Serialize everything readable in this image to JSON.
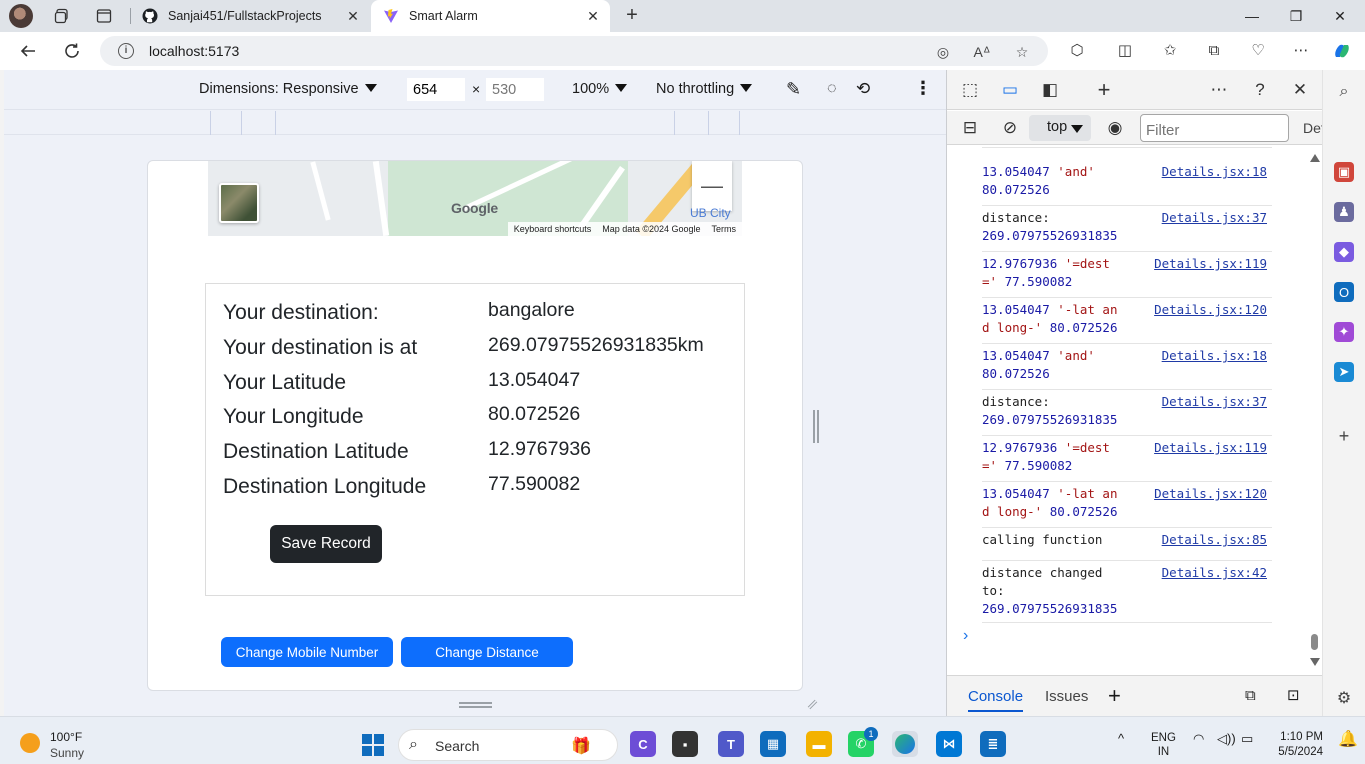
{
  "browser": {
    "tabs": [
      {
        "title": "Sanjai451/FullstackProjects",
        "favicon": "github-icon"
      },
      {
        "title": "Smart Alarm",
        "favicon": "vite-icon",
        "active": true
      }
    ],
    "url": "localhost:5173"
  },
  "device_toolbar": {
    "dimensions_label": "Dimensions: Responsive",
    "width_value": "654",
    "times": "×",
    "height_value": "530",
    "zoom": "100%",
    "throttling": "No throttling"
  },
  "map": {
    "brand": "Google",
    "shortcuts": "Keyboard shortcuts",
    "map_data": "Map data ©2024 Google",
    "terms": "Terms",
    "zoom_out": "—",
    "place_label": "UB City"
  },
  "details": {
    "rows": [
      {
        "label": "Your destination:",
        "value": "bangalore"
      },
      {
        "label": "Your destination is at",
        "value": "269.07975526931835km"
      },
      {
        "label": "Your Latitude",
        "value": "13.054047"
      },
      {
        "label": "Your Longitude",
        "value": "80.072526"
      },
      {
        "label": "Destination Latitude",
        "value": "12.9767936"
      },
      {
        "label": "Destination Longitude",
        "value": "77.590082"
      }
    ],
    "save_button": "Save Record"
  },
  "actions": {
    "change_mobile": "Change Mobile Number",
    "change_distance": "Change Distance"
  },
  "devtools": {
    "context": "top",
    "filter_placeholder": "Filter",
    "filter_tail": "Def",
    "logs": [
      {
        "parts": [
          [
            "num",
            "13.054047"
          ],
          [
            "txt",
            " "
          ],
          [
            "str",
            "'and'"
          ],
          [
            "txt",
            "\n"
          ],
          [
            "num",
            "80.072526"
          ]
        ],
        "source": "Details.jsx:18"
      },
      {
        "parts": [
          [
            "txt",
            "distance:\n"
          ],
          [
            "num",
            "269.07975526931835"
          ]
        ],
        "source": "Details.jsx:37"
      },
      {
        "parts": [
          [
            "num",
            "12.9767936"
          ],
          [
            "txt",
            " "
          ],
          [
            "str",
            "'=dest\n='"
          ],
          [
            "txt",
            " "
          ],
          [
            "num",
            "77.590082"
          ]
        ],
        "source": "Details.jsx:119"
      },
      {
        "parts": [
          [
            "num",
            "13.054047"
          ],
          [
            "txt",
            " "
          ],
          [
            "str",
            "'-lat an\nd long-'"
          ],
          [
            "txt",
            " "
          ],
          [
            "num",
            "80.072526"
          ]
        ],
        "source": "Details.jsx:120"
      },
      {
        "parts": [
          [
            "num",
            "13.054047"
          ],
          [
            "txt",
            " "
          ],
          [
            "str",
            "'and'"
          ],
          [
            "txt",
            "\n"
          ],
          [
            "num",
            "80.072526"
          ]
        ],
        "source": "Details.jsx:18"
      },
      {
        "parts": [
          [
            "txt",
            "distance:\n"
          ],
          [
            "num",
            "269.07975526931835"
          ]
        ],
        "source": "Details.jsx:37"
      },
      {
        "parts": [
          [
            "num",
            "12.9767936"
          ],
          [
            "txt",
            " "
          ],
          [
            "str",
            "'=dest\n='"
          ],
          [
            "txt",
            " "
          ],
          [
            "num",
            "77.590082"
          ]
        ],
        "source": "Details.jsx:119"
      },
      {
        "parts": [
          [
            "num",
            "13.054047"
          ],
          [
            "txt",
            " "
          ],
          [
            "str",
            "'-lat an\nd long-'"
          ],
          [
            "txt",
            " "
          ],
          [
            "num",
            "80.072526"
          ]
        ],
        "source": "Details.jsx:120"
      },
      {
        "parts": [
          [
            "txt",
            "calling function"
          ]
        ],
        "source": "Details.jsx:85"
      },
      {
        "parts": [
          [
            "txt",
            "distance changed\nto:\n"
          ],
          [
            "num",
            "269.07975526931835"
          ]
        ],
        "source": "Details.jsx:42"
      }
    ],
    "drawer_tabs": [
      "Console",
      "Issues"
    ]
  },
  "taskbar": {
    "temperature": "100°F",
    "condition": "Sunny",
    "search_label": "Search",
    "notification_count": "1",
    "lang_line1": "ENG",
    "lang_line2": "IN",
    "time": "1:10 PM",
    "date": "5/5/2024"
  },
  "colors": {
    "primary_button": "#0d6efd",
    "dark_button": "#212529",
    "link": "#1f3aa6",
    "string": "#a31515",
    "number": "#1a1aa6"
  }
}
